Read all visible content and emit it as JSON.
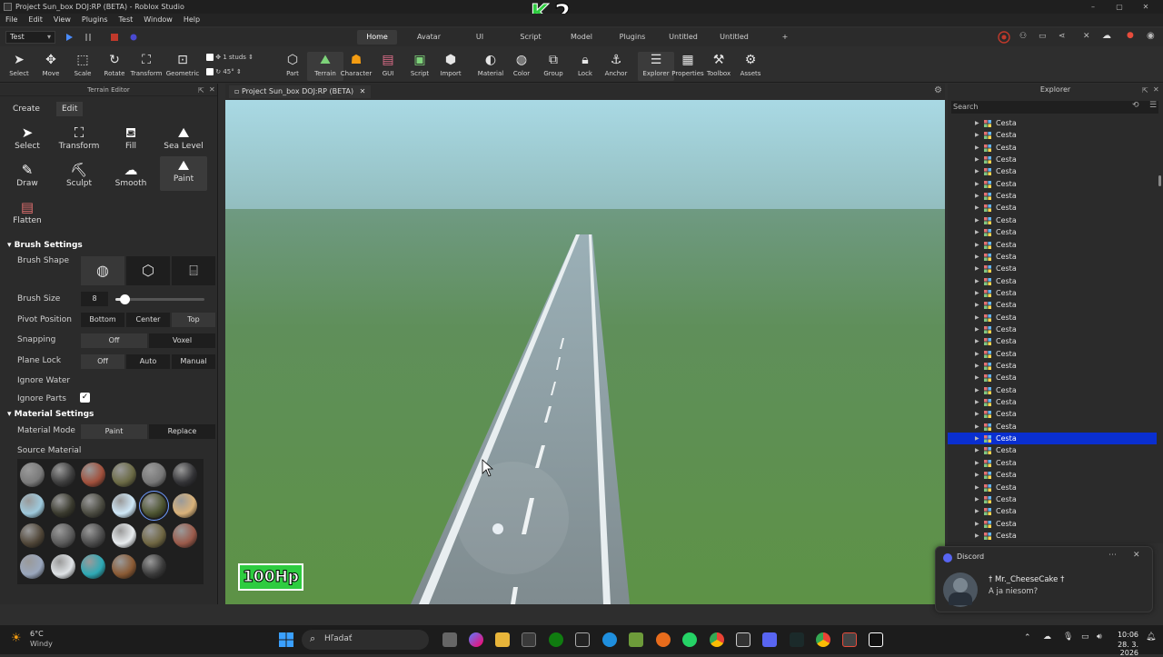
{
  "window": {
    "title": "Project Sun_box DOJ:RP (BETA) - Roblox Studio",
    "overlay_logo": "K 2"
  },
  "menu": [
    "File",
    "Edit",
    "View",
    "Plugins",
    "Test",
    "Window",
    "Help"
  ],
  "mode": "Test",
  "ribbon_tabs": [
    {
      "label": "Home",
      "active": true
    },
    {
      "label": "Avatar",
      "active": false
    },
    {
      "label": "UI",
      "active": false
    },
    {
      "label": "Script",
      "active": false
    },
    {
      "label": "Model",
      "active": false
    },
    {
      "label": "Plugins",
      "active": false
    },
    {
      "label": "Untitled",
      "active": false
    },
    {
      "label": "Untitled",
      "active": false
    },
    {
      "label": "+",
      "active": false
    }
  ],
  "ribbon": {
    "tools": [
      {
        "label": "Select",
        "icon": "cursor-icon"
      },
      {
        "label": "Move",
        "icon": "move-icon"
      },
      {
        "label": "Scale",
        "icon": "scale-icon"
      },
      {
        "label": "Rotate",
        "icon": "rotate-icon"
      },
      {
        "label": "Transform",
        "icon": "transform-icon"
      },
      {
        "label": "Geometric",
        "icon": "geometric-icon"
      }
    ],
    "snap_studs": "1 studs",
    "snap_angle": "45°",
    "insert": [
      {
        "label": "Part",
        "icon": "part-icon"
      },
      {
        "label": "Terrain",
        "icon": "terrain-icon"
      },
      {
        "label": "Character",
        "icon": "character-icon"
      },
      {
        "label": "GUI",
        "icon": "gui-icon"
      },
      {
        "label": "Script",
        "icon": "script-icon"
      },
      {
        "label": "Import",
        "icon": "import-icon"
      }
    ],
    "edit": [
      {
        "label": "Material",
        "icon": "material-icon"
      },
      {
        "label": "Color",
        "icon": "color-icon"
      },
      {
        "label": "Group",
        "icon": "group-icon"
      },
      {
        "label": "Lock",
        "icon": "lock-icon"
      },
      {
        "label": "Anchor",
        "icon": "anchor-icon"
      }
    ],
    "panels": [
      {
        "label": "Explorer",
        "icon": "explorer-icon"
      },
      {
        "label": "Properties",
        "icon": "properties-icon"
      },
      {
        "label": "Toolbox",
        "icon": "toolbox-icon"
      },
      {
        "label": "Assets",
        "icon": "assets-icon"
      }
    ]
  },
  "terrain_editor": {
    "title": "Terrain Editor",
    "tabs": [
      {
        "label": "Create",
        "active": false
      },
      {
        "label": "Edit",
        "active": true
      }
    ],
    "tools": [
      {
        "label": "Select",
        "icon": "cursor-icon"
      },
      {
        "label": "Transform",
        "icon": "transform-icon"
      },
      {
        "label": "Fill",
        "icon": "fill-icon"
      },
      {
        "label": "Sea Level",
        "icon": "sea-level-icon"
      },
      {
        "label": "Draw",
        "icon": "draw-icon"
      },
      {
        "label": "Sculpt",
        "icon": "sculpt-icon"
      },
      {
        "label": "Smooth",
        "icon": "smooth-icon"
      },
      {
        "label": "Paint",
        "icon": "paint-icon",
        "active": true
      },
      {
        "label": "Flatten",
        "icon": "flatten-icon"
      }
    ],
    "brush_settings": {
      "header": "Brush Settings",
      "brush_shape_label": "Brush Shape",
      "brush_size_label": "Brush Size",
      "brush_size": "8",
      "brush_size_fraction": 0.1,
      "pivot_label": "Pivot Position",
      "pivot_options": [
        "Bottom",
        "Center",
        "Top"
      ],
      "snapping_label": "Snapping",
      "snapping_options": [
        "Off",
        "Voxel"
      ],
      "plane_lock_label": "Plane Lock",
      "plane_lock_options": [
        "Off",
        "Auto",
        "Manual"
      ],
      "ignore_water_label": "Ignore Water",
      "ignore_water": false,
      "ignore_parts_label": "Ignore Parts",
      "ignore_parts": true
    },
    "material_settings": {
      "header": "Material Settings",
      "mode_label": "Material Mode",
      "mode_options": [
        "Paint",
        "Replace"
      ],
      "source_label": "Source Material",
      "swatches": [
        "#7a7a7a",
        "#3d3d3d",
        "#a0503c",
        "#6b6a45",
        "#777777",
        "#333336",
        "#9ec9dc",
        "#3a3a2e",
        "#4a4a40",
        "#cfe8f8",
        "#4e5532",
        "#d9b27a",
        "#504638",
        "#5a5a5a",
        "#4b4b4b",
        "#e8ecef",
        "#6f6642",
        "#9a5a4a",
        "#9aa7bd",
        "#dfe3e6",
        "#2ea9b5",
        "#8a5a34",
        "#3a3a3a"
      ]
    }
  },
  "viewport": {
    "tab_label": "Project Sun_box DOJ:RP (BETA)",
    "hp_label": "100Hp"
  },
  "explorer": {
    "title": "Explorer",
    "search_placeholder": "Search",
    "item_label": "Cesta",
    "selected_index": 26,
    "count": 35
  },
  "toast": {
    "app": "Discord",
    "user": "† Mr._CheeseCake †",
    "message": "A ja niesom?"
  },
  "taskbar": {
    "weather_temp": "6°C",
    "weather_desc": "Windy",
    "search_placeholder": "Hľadať",
    "time": "10:06",
    "date": "28. 3. 2026"
  }
}
